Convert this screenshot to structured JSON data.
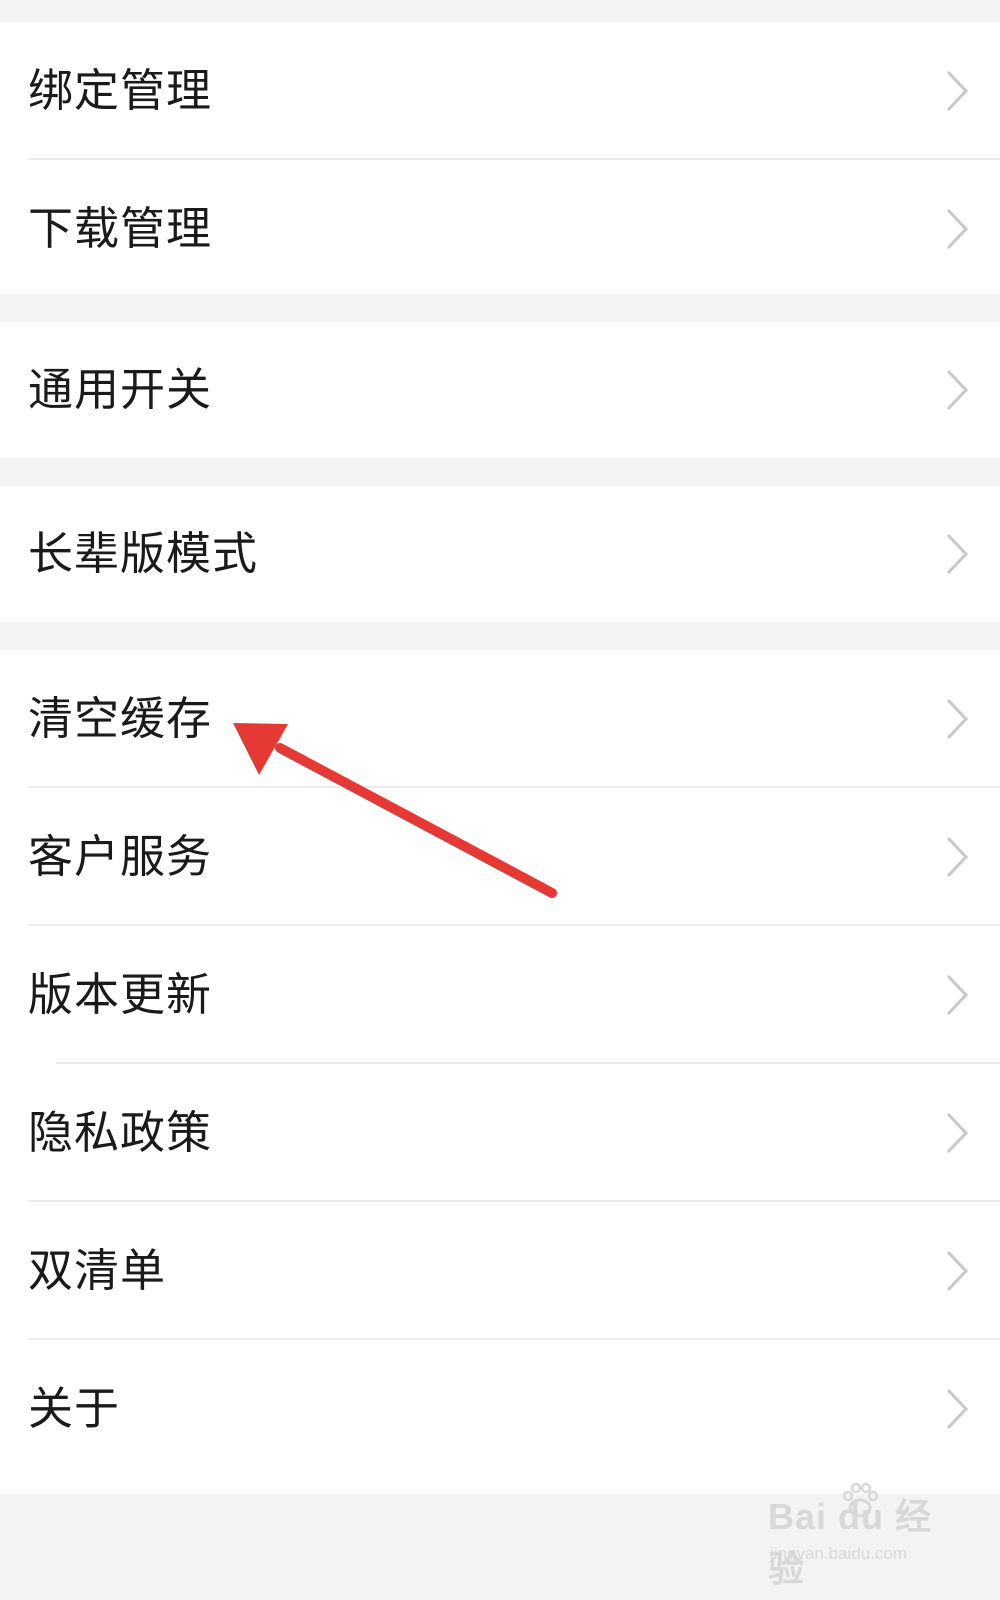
{
  "settings": {
    "group1": [
      {
        "label": "绑定管理"
      },
      {
        "label": "下载管理"
      }
    ],
    "group2": [
      {
        "label": "通用开关"
      }
    ],
    "group3": [
      {
        "label": "长辈版模式"
      }
    ],
    "group4": [
      {
        "label": "清空缓存"
      },
      {
        "label": "客户服务"
      },
      {
        "label": "版本更新"
      },
      {
        "label": "隐私政策"
      },
      {
        "label": "双清单"
      },
      {
        "label": "关于"
      }
    ]
  },
  "annotation": {
    "arrow_color": "#e53935",
    "arrow_target": "清空缓存"
  },
  "watermark": {
    "brand": "Bai du 经验",
    "sub": "jingyan.baidu.com"
  },
  "icons": {
    "row_chevron": "chevron-right-icon",
    "annotation_arrow": "red-arrow-icon",
    "watermark_logo": "paw-icon"
  },
  "colors": {
    "background": "#f3f3f3",
    "card": "#ffffff",
    "text": "#1a1a1a",
    "chevron": "#c8c8c8",
    "divider": "#ebebeb"
  }
}
